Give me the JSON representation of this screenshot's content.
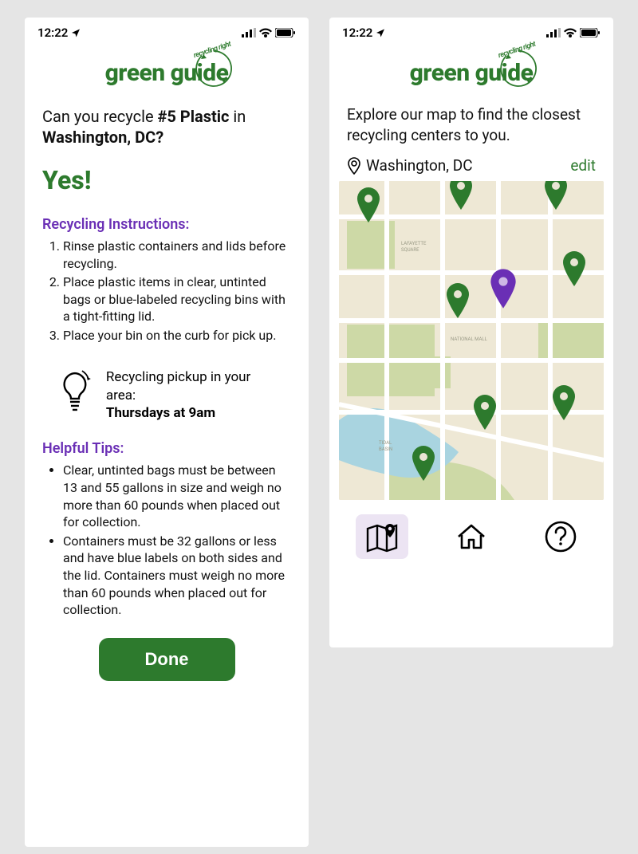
{
  "status": {
    "time": "12:22"
  },
  "logo": {
    "brand": "green guide",
    "tagline": "recycling right"
  },
  "left": {
    "question_prefix": "Can you recycle ",
    "question_item": "#5 Plastic",
    "question_mid": " in ",
    "question_location": "Washington, DC?",
    "answer": "Yes!",
    "instructions_header": "Recycling Instructions:",
    "instructions": [
      "Rinse plastic containers and lids before recycling.",
      "Place plastic items in clear, untinted bags or blue-labeled recycling bins with a tight-fitting lid.",
      "Place your bin on the curb for pick up."
    ],
    "pickup_label": "Recycling pickup in your area:",
    "pickup_time": "Thursdays at 9am",
    "tips_header": "Helpful Tips:",
    "tips": [
      "Clear, untinted bags must be between 13 and 55 gallons in size and weigh no more than 60 pounds when placed out for collection.",
      "Containers must be 32 gallons or less and have blue labels on both sides and the lid. Containers must weigh no more than 60 pounds when placed out for collection."
    ],
    "done_label": "Done"
  },
  "right": {
    "explore": "Explore our map to find the closest recycling centers to you.",
    "location": "Washington, DC",
    "edit_label": "edit",
    "nav": {
      "map": "map-icon",
      "home": "home-icon",
      "help": "help-icon"
    }
  }
}
